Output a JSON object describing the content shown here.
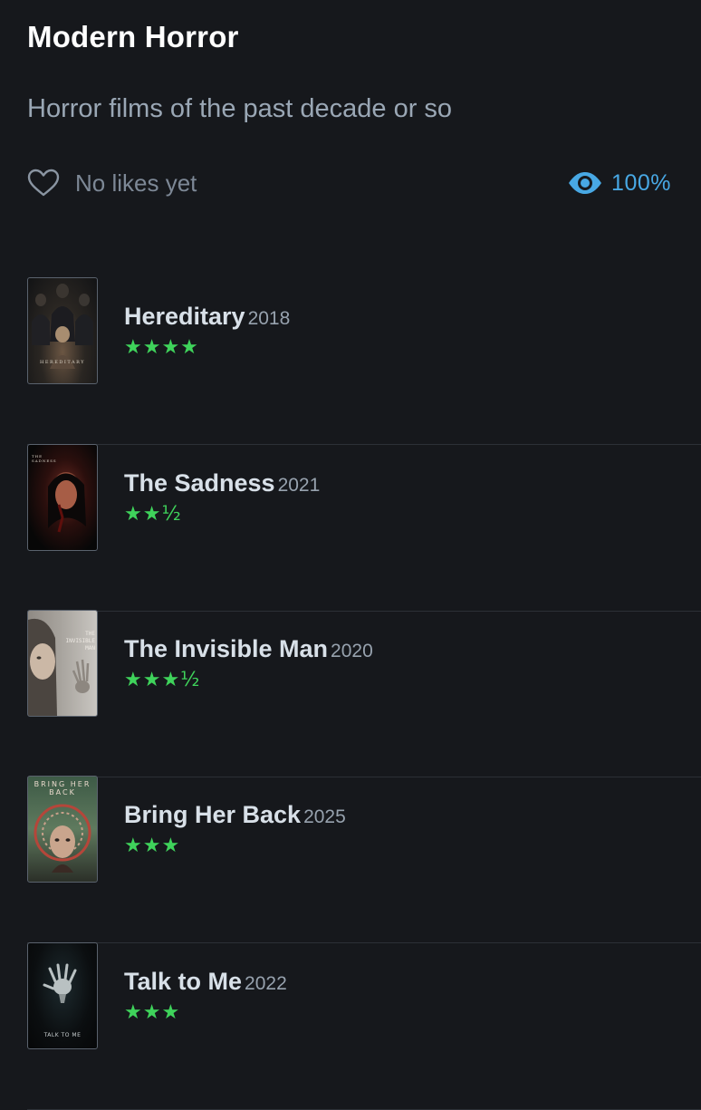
{
  "list": {
    "title": "Modern Horror",
    "description": "Horror films of the past decade or so",
    "likes_text": "No likes yet",
    "progress_text": "100%"
  },
  "colors": {
    "background": "#16181c",
    "rating_green": "#3fd35b",
    "progress_blue": "#48a8e4"
  },
  "icons": {
    "like": "heart-outline-icon",
    "watched": "eye-icon"
  },
  "films": [
    {
      "title": "Hereditary",
      "year": "2018",
      "rating": "★★★★",
      "poster_text": "HEREDITARY"
    },
    {
      "title": "The Sadness",
      "year": "2021",
      "rating": "★★½",
      "poster_text": "THE SADNESS"
    },
    {
      "title": "The Invisible Man",
      "year": "2020",
      "rating": "★★★½",
      "poster_text": "THE INVISIBLE MAN"
    },
    {
      "title": "Bring Her Back",
      "year": "2025",
      "rating": "★★★",
      "poster_text": "BRING HER BACK"
    },
    {
      "title": "Talk to Me",
      "year": "2022",
      "rating": "★★★",
      "poster_text": "TALK TO ME"
    }
  ]
}
